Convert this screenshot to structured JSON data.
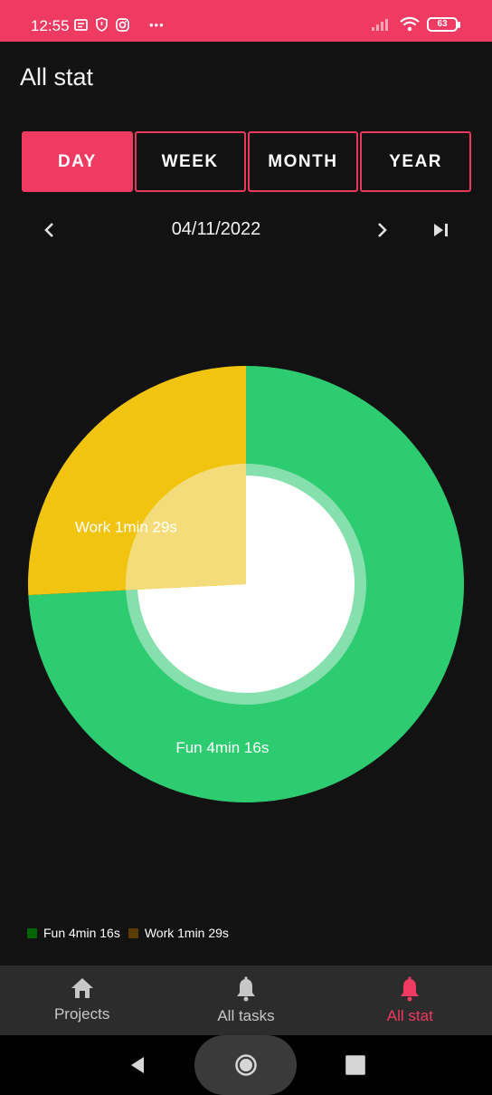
{
  "status_bar": {
    "time": "12:55",
    "battery": "63",
    "overflow": "•••"
  },
  "header": {
    "title": "All stat"
  },
  "period_tabs": [
    {
      "label": "DAY",
      "active": true
    },
    {
      "label": "WEEK",
      "active": false
    },
    {
      "label": "MONTH",
      "active": false
    },
    {
      "label": "YEAR",
      "active": false
    }
  ],
  "date_nav": {
    "date": "04/11/2022"
  },
  "chart_data": {
    "type": "pie",
    "categories": [
      "Fun",
      "Work"
    ],
    "values": [
      256,
      89
    ],
    "slice_labels": [
      "Fun 4min 16s",
      "Work 1min 29s"
    ],
    "colors": [
      "#2ecc71",
      "#f1c40f"
    ]
  },
  "legend": [
    {
      "label": "Fun 4min 16s",
      "color": "#006400"
    },
    {
      "label": "Work 1min 29s",
      "color": "#5c3c00"
    }
  ],
  "bottom_nav": [
    {
      "label": "Projects",
      "icon": "home-icon",
      "active": false
    },
    {
      "label": "All tasks",
      "icon": "bell-icon",
      "active": false
    },
    {
      "label": "All stat",
      "icon": "bell-icon",
      "active": true
    }
  ],
  "colors": {
    "accent": "#ef3a61",
    "background": "#121212",
    "nav_bg": "#2c2c2c"
  }
}
